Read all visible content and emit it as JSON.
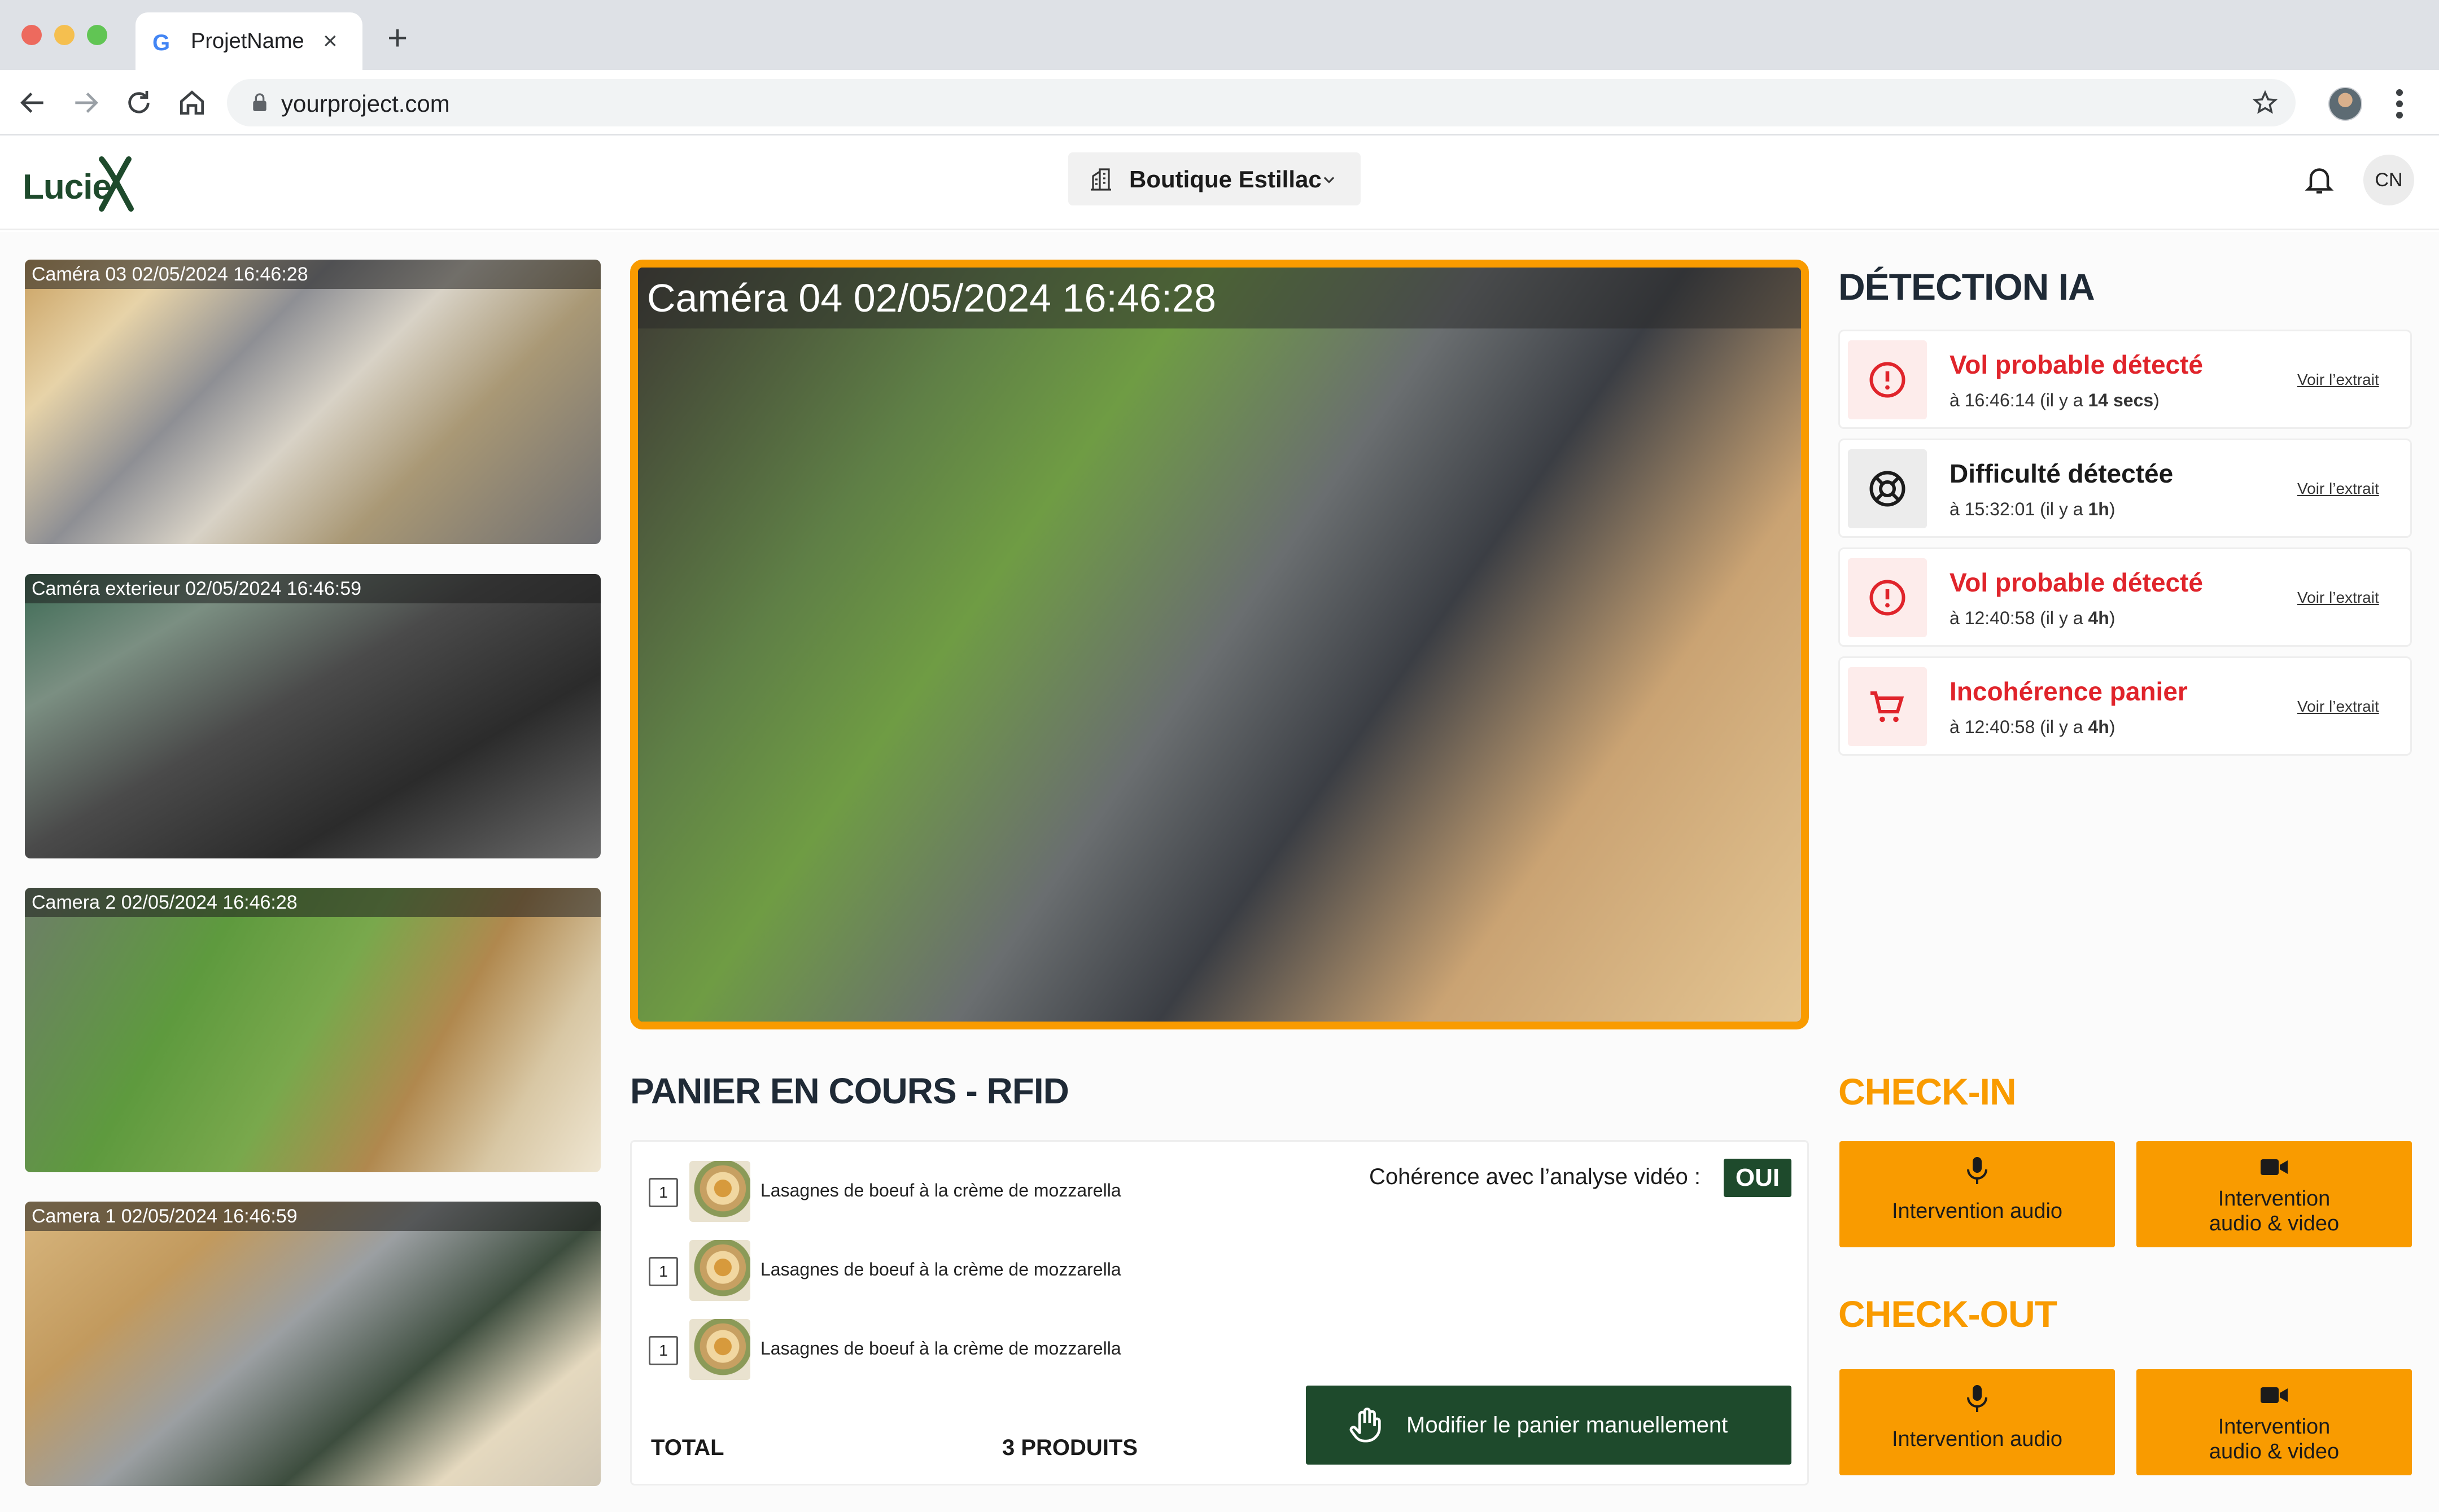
{
  "browser": {
    "tab_title": "ProjetName",
    "url": "yourproject.com",
    "new_tab": "+",
    "close_tab": "×"
  },
  "header": {
    "logo": "Lucie",
    "store_name": "Boutique Estillac",
    "avatar_initials": "CN"
  },
  "cameras": {
    "side": [
      {
        "label": "Caméra 03 02/05/2024 16:46:28"
      },
      {
        "label": "Caméra exterieur 02/05/2024 16:46:59"
      },
      {
        "label": "Camera 2 02/05/2024 16:46:28"
      },
      {
        "label": "Camera 1 02/05/2024 16:46:59"
      }
    ],
    "main": {
      "label": "Caméra 04 02/05/2024 16:46:28"
    },
    "accent_color": "#f99b00"
  },
  "detection": {
    "title": "DÉTECTION IA",
    "link_label": "Voir l’extrait",
    "items": [
      {
        "title": "Vol probable détecté",
        "time": "à 16:46:14 (il y a ",
        "ago": "14 secs",
        "close": ")",
        "icon": "alert-circle-icon",
        "color": "#e0242b"
      },
      {
        "title": "Difficulté détectée",
        "time": "à 15:32:01 (il y a ",
        "ago": "1h",
        "close": ")",
        "icon": "lifebuoy-icon",
        "color": "#1b1b1b"
      },
      {
        "title": "Vol probable détecté",
        "time": "à 12:40:58 (il y a ",
        "ago": "4h",
        "close": ")",
        "icon": "alert-circle-icon",
        "color": "#e0242b"
      },
      {
        "title": "Incohérence panier",
        "time": "à 12:40:58 (il y a ",
        "ago": "4h",
        "close": ")",
        "icon": "cart-icon",
        "color": "#e0242b"
      }
    ]
  },
  "panier": {
    "title": "PANIER EN COURS - RFID",
    "coherence_label": "Cohérence avec l’analyse vidéo :",
    "coherence_value": "OUI",
    "items": [
      {
        "qty": "1",
        "name": "Lasagnes de boeuf à la crème de mozzarella"
      },
      {
        "qty": "1",
        "name": "Lasagnes de boeuf à la crème de mozzarella"
      },
      {
        "qty": "1",
        "name": "Lasagnes de boeuf à la crème de mozzarella"
      }
    ],
    "total_label": "TOTAL",
    "total_value": "3 PRODUITS",
    "modify_button": "Modifier le panier manuellement"
  },
  "checkin": {
    "title": "CHECK-IN",
    "audio_label": "Intervention audio",
    "video_label_1": "Intervention",
    "video_label_2": "audio & video"
  },
  "checkout": {
    "title": "CHECK-OUT",
    "audio_label": "Intervention audio",
    "video_label_1": "Intervention",
    "video_label_2": "audio & video"
  },
  "colors": {
    "brand_green": "#1e4a2c",
    "accent_orange": "#f99b00",
    "alert_red": "#e0242b"
  }
}
